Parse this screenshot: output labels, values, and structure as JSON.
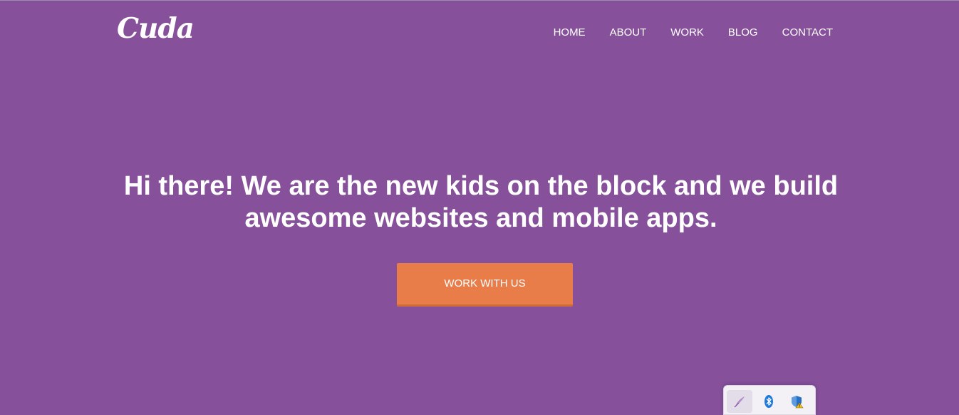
{
  "header": {
    "logo_text": "Cuda",
    "nav": [
      {
        "label": "HOME"
      },
      {
        "label": "ABOUT"
      },
      {
        "label": "WORK"
      },
      {
        "label": "BLOG"
      },
      {
        "label": "CONTACT"
      }
    ]
  },
  "hero": {
    "title": "Hi there! We are the new kids on the block and we build awesome websites and mobile apps.",
    "cta_label": "WORK WITH US"
  },
  "tray": {
    "icons": [
      "feather-pen-icon",
      "bluetooth-icon",
      "security-shield-warning-icon"
    ]
  },
  "colors": {
    "background": "#86509b",
    "accent": "#e97d4a",
    "text": "#ffffff"
  }
}
